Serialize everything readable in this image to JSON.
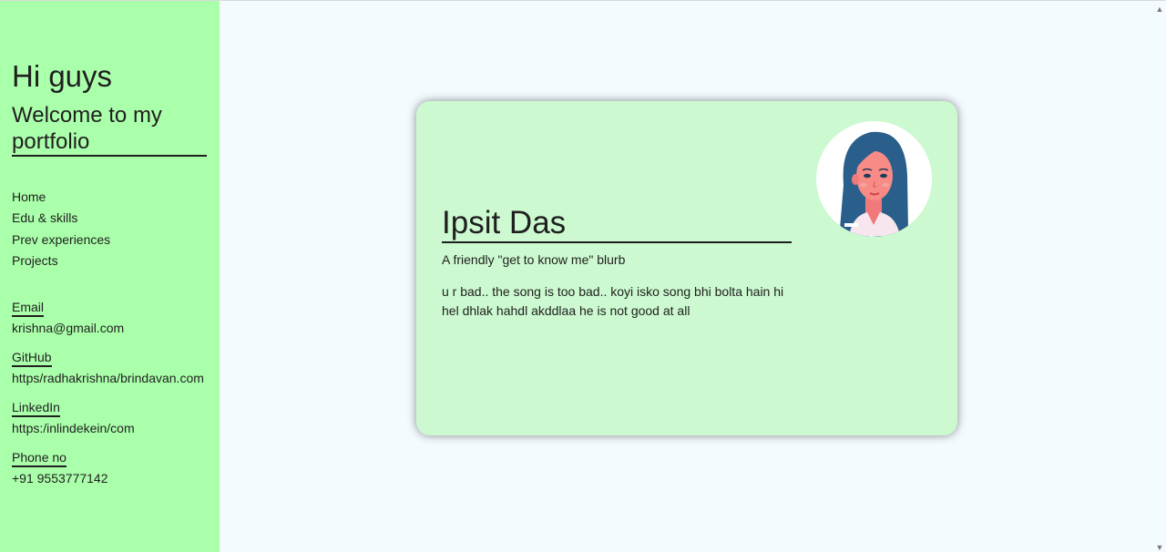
{
  "sidebar": {
    "title": "Hi guys",
    "subtitle": "Welcome to my portfolio",
    "nav": [
      "Home",
      "Edu & skills",
      "Prev experiences",
      "Projects"
    ],
    "contacts": {
      "email": {
        "label": "Email",
        "value": "krishna@gmail.com"
      },
      "github": {
        "label": "GitHub",
        "value": "https/radhakrishna/brindavan.com"
      },
      "linkedin": {
        "label": "LinkedIn",
        "value": "https:/inlindekein/com"
      },
      "phone": {
        "label": "Phone no",
        "value": "+91 9553777142"
      }
    },
    "background": "#aaffaa"
  },
  "card": {
    "name": "Ipsit Das",
    "tagline": "A friendly \"get to know me\" blurb",
    "blurb": "u r bad.. the song is too bad.. koyi isko song bhi bolta hain hi hel dhlak hahdl akddlaa he is not good at all",
    "avatar_icon": "woman-avatar-icon",
    "background": "#ccf9d0"
  },
  "scrollbar": {
    "up_icon": "scroll-up-arrow-icon",
    "down_icon": "scroll-down-arrow-icon"
  }
}
